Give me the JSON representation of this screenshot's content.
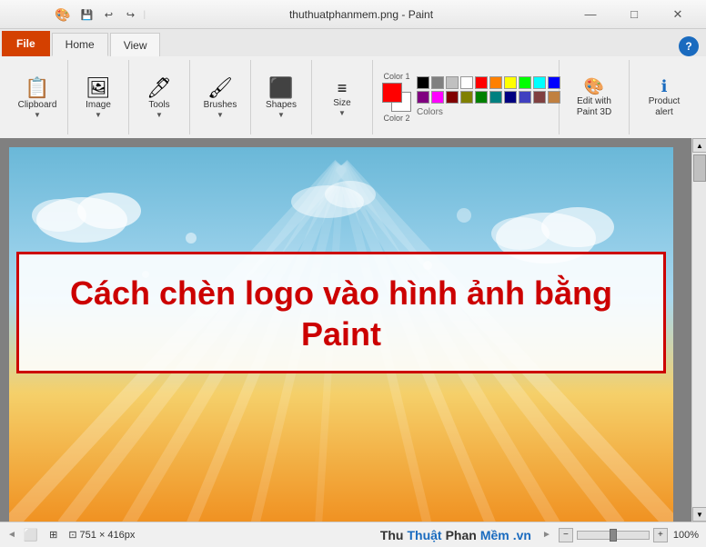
{
  "titlebar": {
    "title": "thuthuatphanmem.png - Paint",
    "minimize": "—",
    "maximize": "□",
    "close": "✕"
  },
  "tabs": {
    "file": "File",
    "home": "Home",
    "view": "View"
  },
  "toolbar": {
    "clipboard_label": "Clipboard",
    "image_label": "Image",
    "tools_label": "Tools",
    "brushes_label": "Brushes",
    "shapes_label": "Shapes",
    "size_label": "Size",
    "colors_label": "Colors",
    "edit_paint3d_label": "Edit with\nPaint 3D",
    "product_alert_label": "Product\nalert"
  },
  "canvas": {
    "main_text_line1": "Cách chèn logo vào hình ảnh bằng",
    "main_text_line2": "Paint"
  },
  "statusbar": {
    "dimensions": "751 × 416px",
    "zoom": "100%",
    "brand_thu": "Thu",
    "brand_thuat": "Thuật",
    "brand_phan": "Phan",
    "brand_mem": "Mềm",
    "brand_dot": ".",
    "brand_vn": "vn"
  },
  "colors": {
    "swatches": [
      "#000000",
      "#808080",
      "#c0c0c0",
      "#ffffff",
      "#ff0000",
      "#ff8000",
      "#ffff00",
      "#00ff00",
      "#00ffff",
      "#0000ff",
      "#800080",
      "#ff00ff",
      "#800000",
      "#808000",
      "#008000",
      "#008080",
      "#000080",
      "#4040c0",
      "#804040",
      "#c08040"
    ]
  }
}
